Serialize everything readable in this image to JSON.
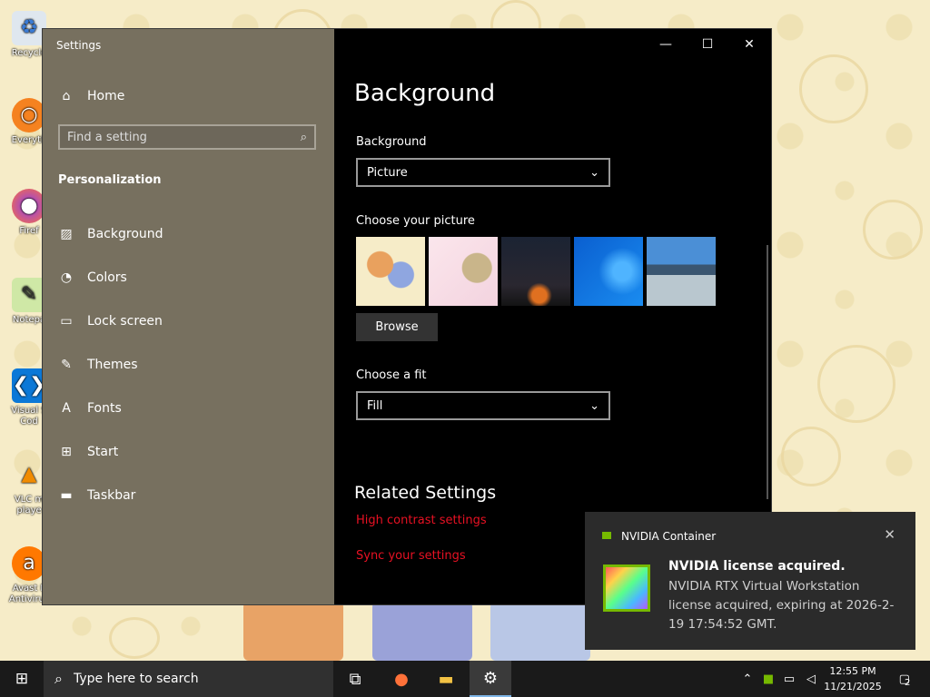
{
  "desktop": {
    "icons": [
      {
        "label": "Recycle",
        "icon": "recycle-bin-icon"
      },
      {
        "label": "Everyth",
        "icon": "everything-search-icon"
      },
      {
        "label": "Firef",
        "icon": "firefox-icon"
      },
      {
        "label": "Notepa",
        "icon": "notepad-icon"
      },
      {
        "label": "Visual S Cod",
        "icon": "vscode-icon"
      },
      {
        "label": "VLC m playe",
        "icon": "vlc-icon"
      },
      {
        "label": "Avast F Antivirus",
        "icon": "avast-icon"
      }
    ]
  },
  "window": {
    "title": "Settings",
    "controls": {
      "minimize": "—",
      "maximize": "☐",
      "close": "✕"
    }
  },
  "sidebar": {
    "home_label": "Home",
    "search_placeholder": "Find a setting",
    "section_title": "Personalization",
    "items": [
      {
        "label": "Background",
        "icon": "picture-icon"
      },
      {
        "label": "Colors",
        "icon": "palette-icon"
      },
      {
        "label": "Lock screen",
        "icon": "lock-screen-icon"
      },
      {
        "label": "Themes",
        "icon": "themes-icon"
      },
      {
        "label": "Fonts",
        "icon": "fonts-icon"
      },
      {
        "label": "Start",
        "icon": "start-icon"
      },
      {
        "label": "Taskbar",
        "icon": "taskbar-icon"
      }
    ]
  },
  "main": {
    "title": "Background",
    "background_label": "Background",
    "background_value": "Picture",
    "choose_picture_label": "Choose your picture",
    "browse_label": "Browse",
    "fit_label": "Choose a fit",
    "fit_value": "Fill",
    "related_title": "Related Settings",
    "links": [
      "High contrast settings",
      "Sync your settings"
    ],
    "accent_link_color": "#e81123"
  },
  "toast": {
    "app_name": "NVIDIA Container",
    "title": "NVIDIA license acquired.",
    "body": "NVIDIA RTX Virtual Workstation license acquired, expiring at 2026-2-19 17:54:52 GMT."
  },
  "taskbar": {
    "search_placeholder": "Type here to search",
    "time": "12:55 PM",
    "date": "11/21/2025",
    "notification_count": "2"
  }
}
